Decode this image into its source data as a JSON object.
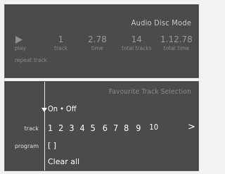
{
  "disc_panel": {
    "title": "Audio Disc Mode",
    "play_label": "play",
    "repeat_label": "repeat track",
    "track": {
      "value": "1",
      "label": "track"
    },
    "time": {
      "value": "2.78",
      "label": "time"
    },
    "total_tracks": {
      "value": "14",
      "label": "total tracks"
    },
    "total_time": {
      "value": "1.12.78",
      "label": "total time"
    }
  },
  "favourites_panel": {
    "title": "Favourite Track Selection",
    "toggle": {
      "on_label": "On",
      "separator": "•",
      "off_label": "Off",
      "selected": "On"
    },
    "track_label": "track",
    "program_label": "program",
    "track_numbers": [
      "1",
      "2",
      "3",
      "4",
      "5",
      "6",
      "7",
      "8",
      "9",
      "10"
    ],
    "next_icon": ">",
    "program_value": "[ ]",
    "clear_all": "Clear all"
  },
  "colors": {
    "panel_bg": "#4b4b4b",
    "page_bg": "#f2f2f2",
    "text_bright": "#ffffff",
    "text_dim": "#8f8f8f"
  },
  "icons": {
    "play": "play-icon",
    "dropdown": "triangle-down-icon",
    "next": "chevron-right-icon"
  }
}
